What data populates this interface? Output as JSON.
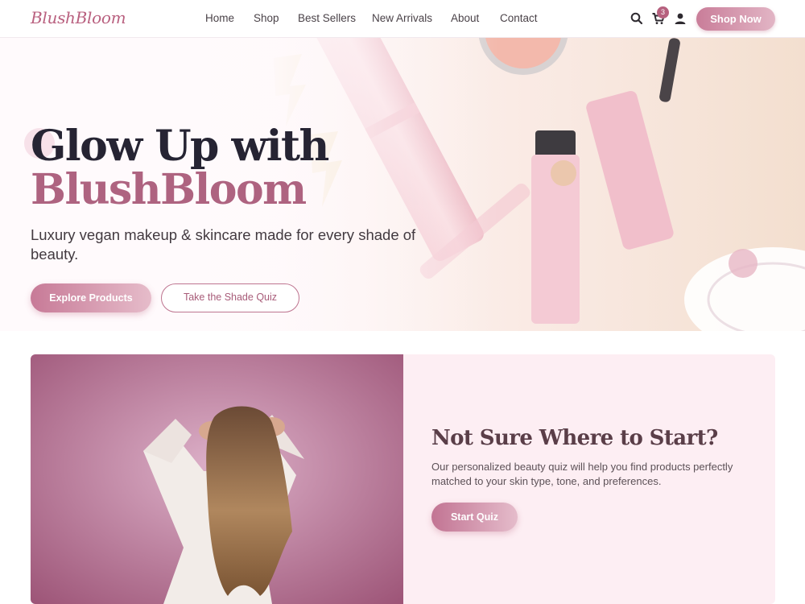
{
  "brand": {
    "logo": "BlushBloom",
    "accent": "#b9607f",
    "dark": "#262433"
  },
  "nav": {
    "links": [
      "Home",
      "Shop",
      "Best Sellers",
      "New Arrivals",
      "About",
      "Contact"
    ],
    "icons": [
      "search-icon",
      "cart-icon",
      "user-icon"
    ],
    "cart_count": "3",
    "cta_label": "Shop Now"
  },
  "hero": {
    "title_line1": "Glow Up with",
    "title_line2": "BlushBloom",
    "subtitle": "Luxury vegan makeup & skincare made for every shade of beauty.",
    "primary_button": "Explore Products",
    "secondary_button": "Take the Shade Quiz"
  },
  "quiz": {
    "title": "Not Sure Where to Start?",
    "text": "Our personalized beauty quiz will help you find products perfectly matched to your skin type, tone, and preferences.",
    "button": "Start Quiz"
  }
}
